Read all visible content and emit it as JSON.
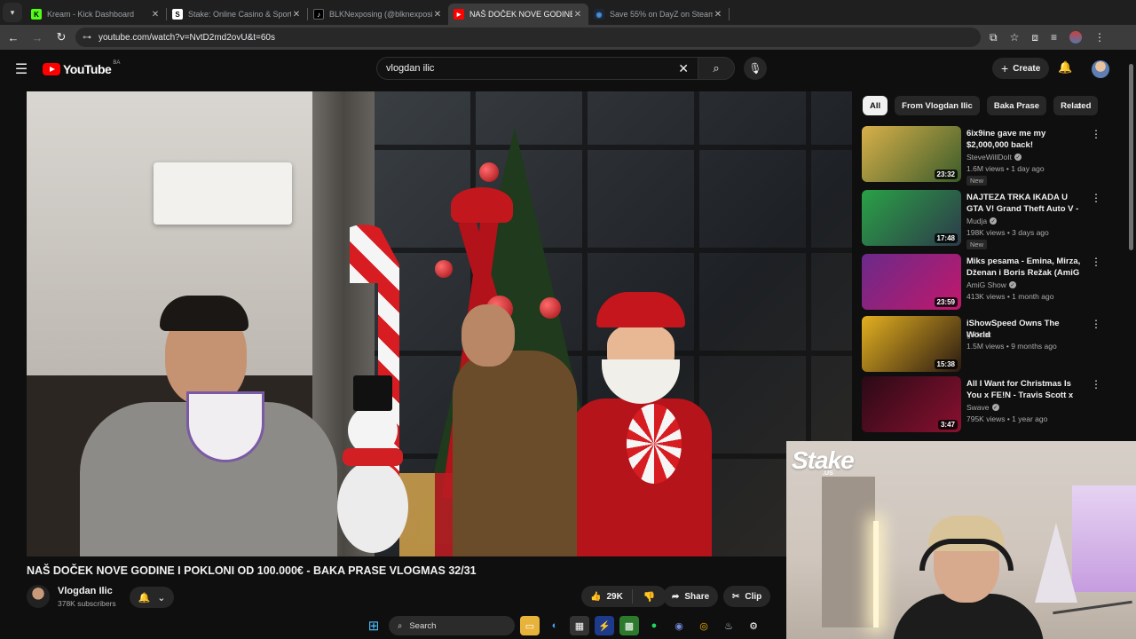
{
  "browser": {
    "tabs": [
      {
        "title": "Kream - Kick Dashboard",
        "favicon": "K",
        "favicon_color": "#53fc18",
        "active": false
      },
      {
        "title": "Stake: Online Casino & Sports",
        "favicon": "S",
        "favicon_color": "#ffffff",
        "active": false
      },
      {
        "title": "BLKNexposing (@blknexposing",
        "favicon": "♪",
        "favicon_color": "#ffffff",
        "active": false
      },
      {
        "title": "NAŠ DOČEK NOVE GODINE I PO",
        "favicon": "▶",
        "favicon_color": "#ff0000",
        "active": true
      },
      {
        "title": "Save 55% on DayZ on Steam",
        "favicon": "◉",
        "favicon_color": "#4a90d9",
        "active": false
      }
    ],
    "url": "youtube.com/watch?v=NvtD2md2ovU&t=60s"
  },
  "youtube": {
    "logo_text": "YouTube",
    "country_code": "BA",
    "search_value": "vlogdan ilic",
    "create_label": "Create"
  },
  "video": {
    "title": "NAŠ DOČEK NOVE GODINE I POKLONI OD 100.000€ - BAKA PRASE VLOGMAS 32/31",
    "channel_name": "Vlogdan Ilic",
    "subscribers": "378K subscribers",
    "likes": "29K",
    "share_label": "Share",
    "clip_label": "Clip"
  },
  "chips": [
    "All",
    "From Vlogdan Ilic",
    "Baka Prase",
    "Related"
  ],
  "related": [
    {
      "title": "6ix9ine gave me my $2,000,000 back!",
      "channel": "SteveWillDoIt",
      "verified": true,
      "meta": "1.6M views • 1 day ago",
      "duration": "23:32",
      "badge": "New",
      "thumb": [
        "#d8b04a",
        "#3a5c2a"
      ]
    },
    {
      "title": "NAJTEZA TRKA IKADA U GTA V! Grand Theft Auto V - Lude ...",
      "channel": "Mudja",
      "verified": true,
      "meta": "198K views • 3 days ago",
      "duration": "17:48",
      "badge": "New",
      "thumb": [
        "#2aa146",
        "#2d3a4a"
      ]
    },
    {
      "title": "Miks pesama - Emina, Mirza, Dženan i Boris Režak (AmiG ...",
      "channel": "AmiG Show",
      "verified": true,
      "meta": "413K views • 1 month ago",
      "duration": "23:59",
      "badge": "",
      "thumb": [
        "#6a2a8a",
        "#c2186b"
      ]
    },
    {
      "title": "iShowSpeed Owns The World",
      "channel": "golfcart",
      "verified": false,
      "meta": "1.5M views • 9 months ago",
      "duration": "15:38",
      "badge": "",
      "thumb": [
        "#e3b020",
        "#2a1a12"
      ]
    },
    {
      "title": "All I Want for Christmas Is You x FE!N - Travis Scott x Mariah ...",
      "channel": "Swave",
      "verified": true,
      "meta": "795K views • 1 year ago",
      "duration": "3:47",
      "badge": "",
      "thumb": [
        "#2a0a16",
        "#8a1030"
      ]
    }
  ],
  "overlay": {
    "brand": "Stake",
    "brand_sub": ".US"
  },
  "taskbar": {
    "search_label": "Search"
  }
}
